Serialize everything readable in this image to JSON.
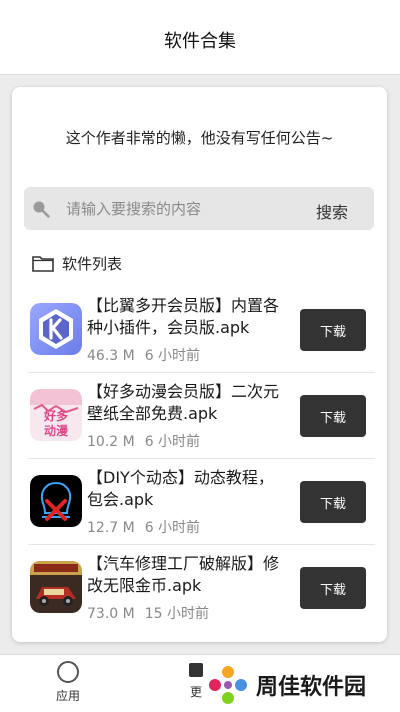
{
  "header": {
    "title": "软件合集"
  },
  "announcement": "这个作者非常的懒，他没有写任何公告~",
  "search": {
    "placeholder": "请输入要搜索的内容",
    "button": "搜索"
  },
  "list": {
    "heading": "软件列表",
    "items": [
      {
        "name": "【比翼多开会员版】内置各种小插件，会员版.apk",
        "size": "46.3 M",
        "time": "6 小时前",
        "button": "下载",
        "icon": "k-app-icon"
      },
      {
        "name": "【好多动漫会员版】二次元壁纸全部免费.apk",
        "size": "10.2 M",
        "time": "6 小时前",
        "button": "下载",
        "icon": "anime-app-icon"
      },
      {
        "name": "【DIY个动态】动态教程，包会.apk",
        "size": "12.7 M",
        "time": "6 小时前",
        "button": "下载",
        "icon": "diy-app-icon"
      },
      {
        "name": "【汽车修理工厂破解版】修改无限金币.apk",
        "size": "73.0 M",
        "time": "15 小时前",
        "button": "下载",
        "icon": "car-game-icon"
      }
    ]
  },
  "bottom_nav": {
    "apps_label": "应用",
    "more_label": "更"
  },
  "watermark": "周佳软件园",
  "colors": {
    "button_bg": "#333333",
    "search_bg": "#e6e6e6",
    "page_bg": "#ececec"
  }
}
